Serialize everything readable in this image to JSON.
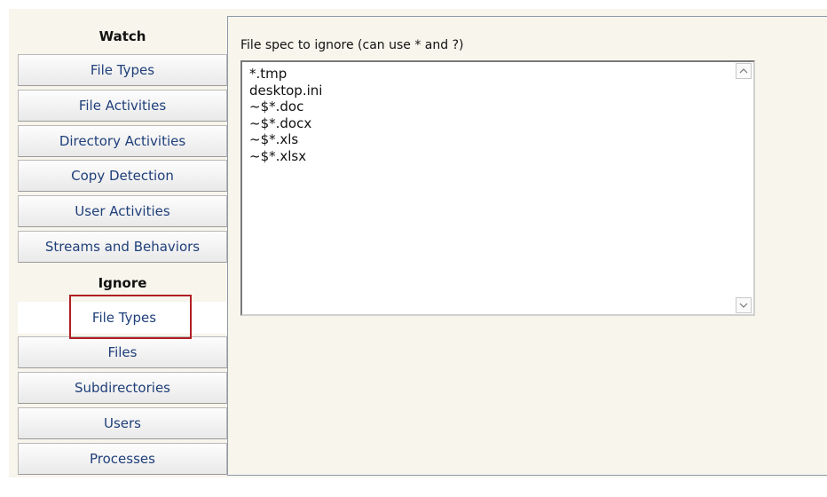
{
  "sidebar": {
    "watch_header": "Watch",
    "watch_items": [
      {
        "label": "File Types"
      },
      {
        "label": "File Activities"
      },
      {
        "label": "Directory Activities"
      },
      {
        "label": "Copy Detection"
      },
      {
        "label": "User Activities"
      },
      {
        "label": "Streams and Behaviors"
      }
    ],
    "ignore_header": "Ignore",
    "ignore_items": [
      {
        "label": "File Types",
        "selected": true
      },
      {
        "label": "Files"
      },
      {
        "label": "Subdirectories"
      },
      {
        "label": "Users"
      },
      {
        "label": "Processes"
      }
    ]
  },
  "content": {
    "field_label": "File spec to ignore (can use * and ?)",
    "specs": [
      "*.tmp",
      "desktop.ini",
      "~$*.doc",
      "~$*.docx",
      "~$*.xls",
      "~$*.xlsx"
    ]
  },
  "icons": {
    "scroll_up": "chevron-up-icon",
    "scroll_down": "chevron-down-icon"
  },
  "colors": {
    "highlight": "#b01e23",
    "panel_bg": "#f7f5ec",
    "button_text": "#1f3f7a"
  }
}
